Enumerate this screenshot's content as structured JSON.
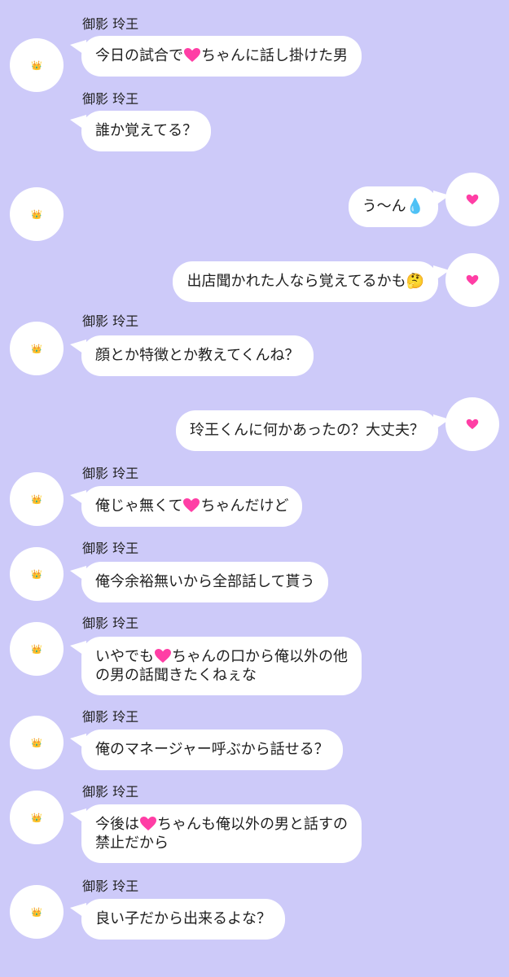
{
  "colors": {
    "background": "#cdcaf9",
    "bubble": "#ffffff",
    "heart": "#ff3ea5",
    "text": "#1f1f1f"
  },
  "icons": {
    "left_avatar": "crown-icon",
    "right_avatar": "heart-icon"
  },
  "messages": [
    {
      "side": "left",
      "name": "御影 玲王",
      "avatar": "👑",
      "parts": [
        {
          "t": "text",
          "v": "今日の試合で"
        },
        {
          "t": "heart"
        },
        {
          "t": "text",
          "v": "ちゃんに話し掛けた男"
        }
      ]
    },
    {
      "side": "left",
      "name": "御影 玲王",
      "avatar": "👑",
      "parts": [
        {
          "t": "text",
          "v": "誰か覚えてる？"
        }
      ]
    },
    {
      "side": "right",
      "avatar": "💗",
      "parts": [
        {
          "t": "text",
          "v": "う〜ん"
        },
        {
          "t": "emoji",
          "v": "💧"
        }
      ]
    },
    {
      "side": "right",
      "avatar": "💗",
      "parts": [
        {
          "t": "text",
          "v": "出店聞かれた人なら覚えてるかも"
        },
        {
          "t": "emoji",
          "v": "🤔"
        }
      ]
    },
    {
      "side": "left",
      "name": "御影 玲王",
      "avatar": "👑",
      "parts": [
        {
          "t": "text",
          "v": "顔とか特徴とか教えてくんね？"
        }
      ]
    },
    {
      "side": "right",
      "avatar": "💗",
      "parts": [
        {
          "t": "text",
          "v": "玲王くんに何かあったの？大丈夫？"
        }
      ]
    },
    {
      "side": "left",
      "name": "御影 玲王",
      "avatar": "👑",
      "parts": [
        {
          "t": "text",
          "v": "俺じゃ無くて"
        },
        {
          "t": "heart"
        },
        {
          "t": "text",
          "v": "ちゃんだけど"
        }
      ]
    },
    {
      "side": "left",
      "name": "御影 玲王",
      "avatar": "👑",
      "parts": [
        {
          "t": "text",
          "v": "俺今余裕無いから全部話して貰う"
        }
      ]
    },
    {
      "side": "left",
      "name": "御影 玲王",
      "avatar": "👑",
      "parts": [
        {
          "t": "text",
          "v": "いやでも"
        },
        {
          "t": "heart"
        },
        {
          "t": "text",
          "v": "ちゃんの口から俺以外の他"
        },
        {
          "t": "br"
        },
        {
          "t": "text",
          "v": "の男の話聞きたくねぇな"
        }
      ]
    },
    {
      "side": "left",
      "name": "御影 玲王",
      "avatar": "👑",
      "parts": [
        {
          "t": "text",
          "v": "俺のマネージャー呼ぶから話せる？"
        }
      ]
    },
    {
      "side": "left",
      "name": "御影 玲王",
      "avatar": "👑",
      "parts": [
        {
          "t": "text",
          "v": "今後は"
        },
        {
          "t": "heart"
        },
        {
          "t": "text",
          "v": "ちゃんも俺以外の男と話すの"
        },
        {
          "t": "br"
        },
        {
          "t": "text",
          "v": "禁止だから"
        }
      ]
    },
    {
      "side": "left",
      "name": "御影 玲王",
      "avatar": "👑",
      "parts": [
        {
          "t": "text",
          "v": "良い子だから出来るよな？"
        }
      ]
    }
  ]
}
